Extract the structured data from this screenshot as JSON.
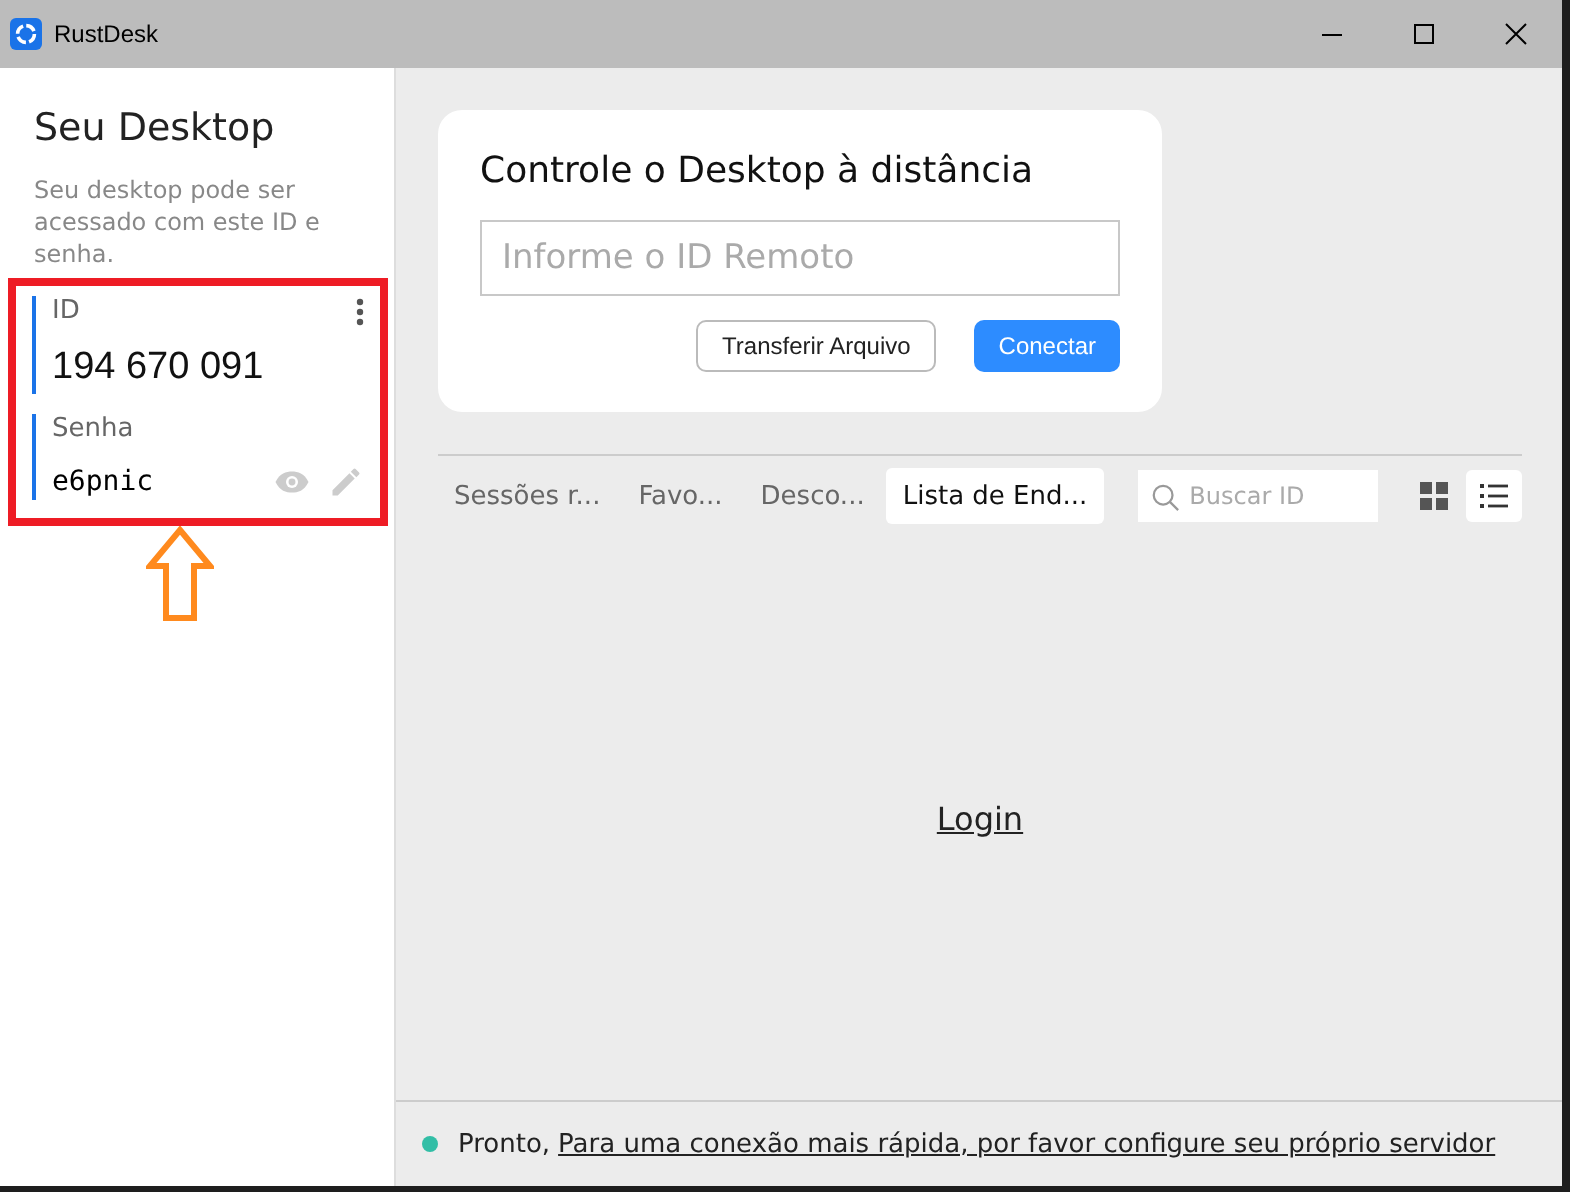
{
  "window": {
    "title": "RustDesk"
  },
  "sidebar": {
    "title": "Seu Desktop",
    "description": "Seu desktop pode ser acessado com este ID e senha.",
    "id_label": "ID",
    "id_value": "194 670 091",
    "password_label": "Senha",
    "password_value": "e6pnic"
  },
  "remote_card": {
    "title": "Controle o Desktop à distância",
    "placeholder": "Informe o ID Remoto",
    "buttons": [
      {
        "label": "Transferir Arquivo",
        "kind": "outline"
      },
      {
        "label": "Conectar",
        "kind": "primary"
      }
    ]
  },
  "tabs": [
    {
      "label": "Sessões r...",
      "selected": false
    },
    {
      "label": "Favo...",
      "selected": false
    },
    {
      "label": "Desco...",
      "selected": false
    },
    {
      "label": "Lista de End...",
      "selected": true
    }
  ],
  "search": {
    "placeholder": "Buscar ID"
  },
  "views": [
    {
      "kind": "grid",
      "selected": false
    },
    {
      "kind": "list",
      "selected": true
    }
  ],
  "content": {
    "login_link": "Login"
  },
  "status_bar": {
    "color": "#32bea6",
    "text": "Pronto,",
    "link": "Para uma conexão mais rápida, por favor configure seu próprio servidor"
  }
}
